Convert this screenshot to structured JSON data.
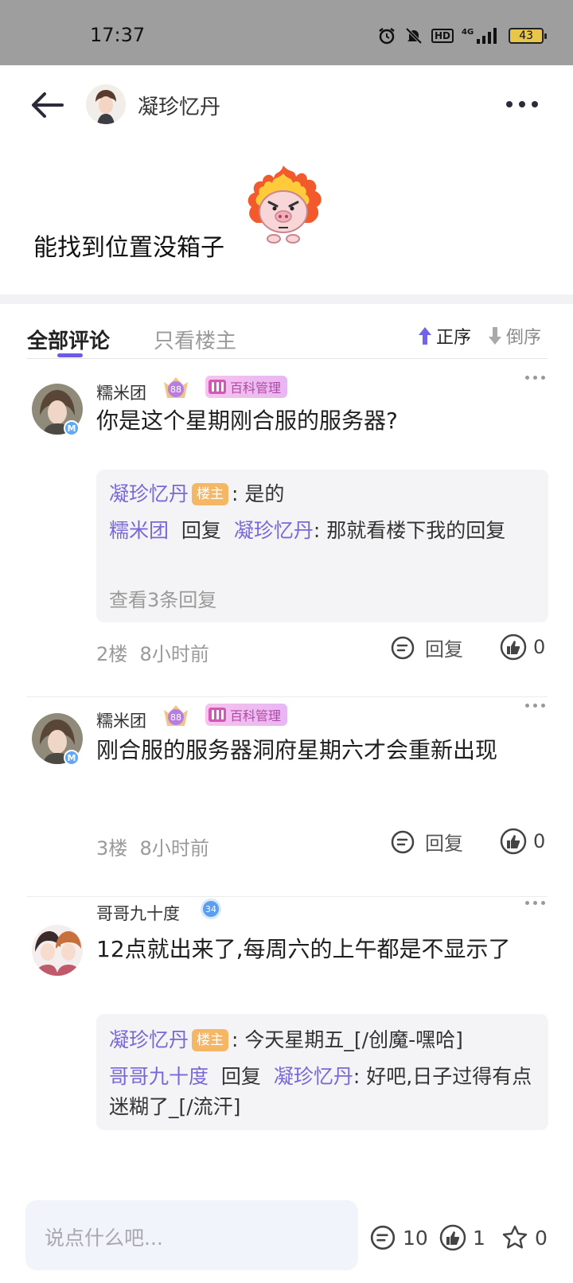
{
  "status_bar": {
    "time": "17:37",
    "network": "4G",
    "hd": "HD",
    "battery": "43"
  },
  "header": {
    "author_name": "凝珍忆丹"
  },
  "post": {
    "text": "能找到位置没箱子"
  },
  "tabs": {
    "all_label": "全部评论",
    "op_only_label": "只看楼主",
    "sort_asc": "正序",
    "sort_desc": "倒序"
  },
  "comments": [
    {
      "user": "糯米团",
      "level": "88",
      "role": "百科管理",
      "text": "你是这个星期刚合服的服务器?",
      "replies": [
        {
          "user": "凝珍忆丹",
          "op_tag": "楼主",
          "sep": ":",
          "text": "是的"
        },
        {
          "user": "糯米团",
          "reply_word": "回复",
          "target": "凝珍忆丹",
          "sep": ":",
          "text": "那就看楼下我的回复"
        }
      ],
      "view_more": "查看3条回复",
      "floor": "2楼",
      "time": "8小时前",
      "reply_label": "回复",
      "likes": "0"
    },
    {
      "user": "糯米团",
      "level": "88",
      "role": "百科管理",
      "text": "刚合服的服务器洞府星期六才会重新出现",
      "floor": "3楼",
      "time": "8小时前",
      "reply_label": "回复",
      "likes": "0"
    },
    {
      "user": "哥哥九十度",
      "level": "34",
      "text": "12点就出来了,每周六的上午都是不显示了",
      "replies": [
        {
          "user": "凝珍忆丹",
          "op_tag": "楼主",
          "sep": ":",
          "text": "今天星期五_[/创魔-嘿哈]"
        },
        {
          "user": "哥哥九十度",
          "reply_word": "回复",
          "target": "凝珍忆丹",
          "sep": ":",
          "text": "好吧,日子过得有点迷糊了_[/流汗]"
        }
      ]
    }
  ],
  "bottom_bar": {
    "placeholder": "说点什么吧...",
    "comment_count": "10",
    "like_count": "1",
    "fav_count": "0"
  },
  "colors": {
    "accent": "#6b5ce7",
    "username": "#7a67d8",
    "op_tag": "#f6b765",
    "role_tag": "#e6b7f3"
  }
}
